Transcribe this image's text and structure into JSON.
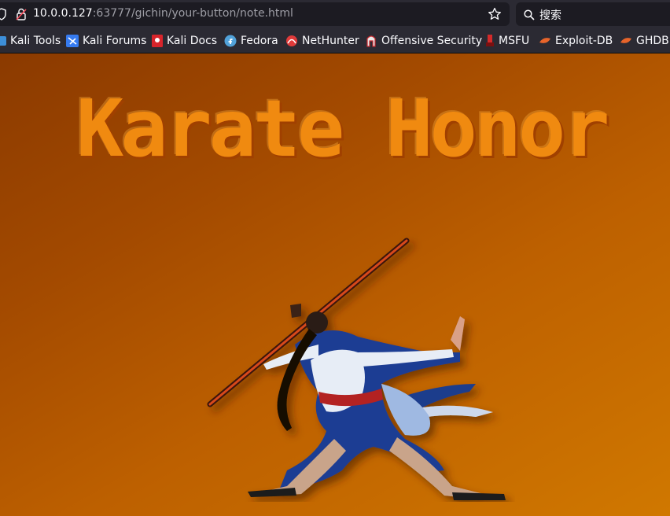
{
  "browser": {
    "url_host": "10.0.0.127",
    "url_rest": ":63777/gichin/your-button/note.html",
    "search_placeholder": "搜索"
  },
  "bookmarks": [
    {
      "label": "Kali Tools",
      "icon": "kali-tools-icon"
    },
    {
      "label": "Kali Forums",
      "icon": "kali-forums-icon"
    },
    {
      "label": "Kali Docs",
      "icon": "kali-docs-icon"
    },
    {
      "label": "Fedora",
      "icon": "fedora-icon"
    },
    {
      "label": "NetHunter",
      "icon": "nethunter-icon"
    },
    {
      "label": "Offensive Security",
      "icon": "offsec-icon"
    },
    {
      "label": "MSFU",
      "icon": "msfu-icon"
    },
    {
      "label": "Exploit-DB",
      "icon": "exploit-db-icon"
    },
    {
      "label": "GHDB",
      "icon": "ghdb-icon"
    }
  ],
  "page": {
    "title": "Karate Honor",
    "image": "karate-fighter-with-staff"
  },
  "colors": {
    "title": "#f08a10",
    "background_start": "#8b3a00",
    "background_end": "#d07800"
  }
}
